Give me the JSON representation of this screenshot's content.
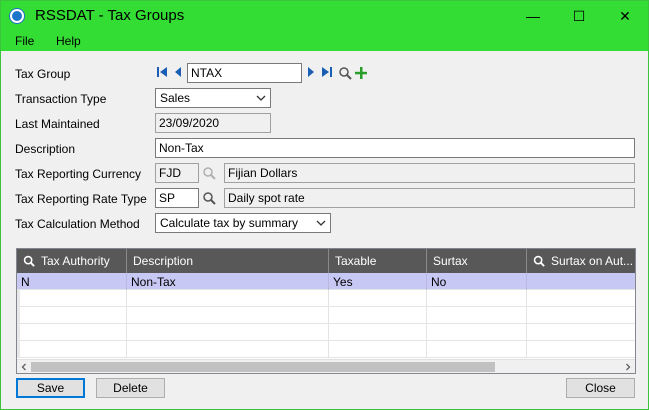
{
  "window": {
    "title": "RSSDAT - Tax Groups",
    "minimize_glyph": "—",
    "maximize_glyph": "☐",
    "close_glyph": "✕"
  },
  "menu": {
    "file": "File",
    "help": "Help"
  },
  "form": {
    "tax_group": {
      "label": "Tax Group",
      "value": "NTAX"
    },
    "transaction_type": {
      "label": "Transaction Type",
      "value": "Sales"
    },
    "last_maintained": {
      "label": "Last Maintained",
      "value": "23/09/2020"
    },
    "description": {
      "label": "Description",
      "value": "Non-Tax"
    },
    "tax_reporting_currency": {
      "label": "Tax Reporting Currency",
      "code": "FJD",
      "name": "Fijian Dollars"
    },
    "tax_reporting_rate_type": {
      "label": "Tax Reporting Rate Type",
      "code": "SP",
      "name": "Daily spot rate"
    },
    "tax_calculation_method": {
      "label": "Tax Calculation Method",
      "value": "Calculate tax by summary"
    }
  },
  "grid": {
    "columns": [
      "Tax Authority",
      "Description",
      "Taxable",
      "Surtax",
      "Surtax on Aut..."
    ],
    "rows": [
      [
        "N",
        "Non-Tax",
        "Yes",
        "No",
        ""
      ]
    ]
  },
  "buttons": {
    "save": "Save",
    "delete": "Delete",
    "close": "Close"
  },
  "colors": {
    "titlebar": "#33dd33",
    "grid_header": "#585858",
    "selected_row": "#c8c8f5",
    "nav_blue": "#1a5fb4",
    "add_green": "#2a9d2a"
  }
}
